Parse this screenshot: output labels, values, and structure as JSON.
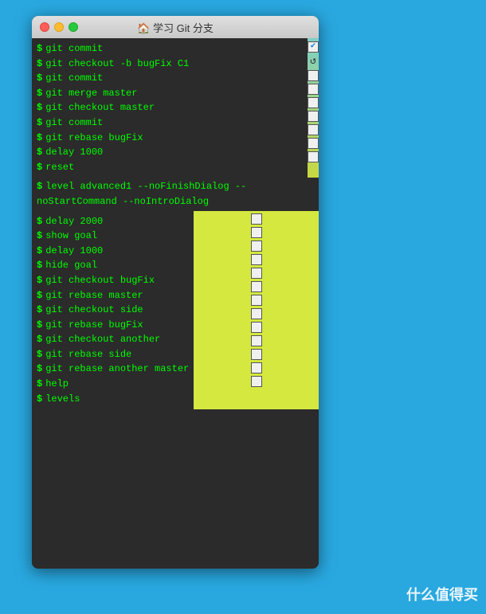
{
  "titlebar": {
    "title": "🏠 学习 Git 分支"
  },
  "watermark": {
    "text": "什么值得买"
  },
  "section1": {
    "commands": [
      "git commit",
      "git checkout -b bugFix C1",
      "git commit",
      "git merge master",
      "git checkout master",
      "git commit",
      "git rebase bugFix",
      "delay 1000",
      "reset"
    ]
  },
  "section2_header": {
    "command": "level advanced1 --noFinishDialog --noStartCommand --noIntroDialog"
  },
  "section2": {
    "commands": [
      "delay 2000",
      "show goal",
      "delay 1000",
      "hide goal",
      "git checkout bugFix",
      "git rebase master",
      "git checkout side",
      "git rebase bugFix",
      "git checkout another",
      "git rebase side",
      "git rebase another master",
      "help",
      "levels"
    ]
  }
}
